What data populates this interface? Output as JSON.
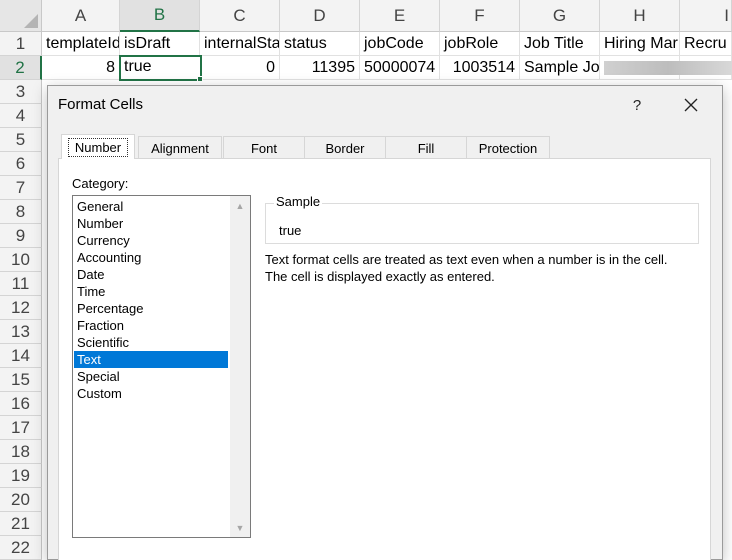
{
  "sheet": {
    "columns": [
      "A",
      "B",
      "C",
      "D",
      "E",
      "F",
      "G",
      "H",
      "I"
    ],
    "rows": [
      "1",
      "2",
      "3",
      "4",
      "5",
      "6",
      "7",
      "8",
      "9",
      "10",
      "11",
      "12",
      "13",
      "14",
      "15",
      "16",
      "17",
      "18",
      "19",
      "20",
      "21",
      "22"
    ],
    "header_row": [
      "templateId",
      "isDraft",
      "internalSta",
      "status",
      "jobCode",
      "jobRole",
      "Job Title",
      "Hiring Mar",
      "Recru"
    ],
    "data_row": [
      "8",
      "true",
      "0",
      "11395",
      "50000074",
      "1003514",
      "Sample Jol",
      "",
      ""
    ],
    "selected_cell": "B2",
    "accent_color": "#217346"
  },
  "dialog": {
    "title": "Format Cells",
    "help_label": "?",
    "tabs": [
      "Number",
      "Alignment",
      "Font",
      "Border",
      "Fill",
      "Protection"
    ],
    "selected_tab": "Number",
    "category_label": "Category:",
    "categories": [
      "General",
      "Number",
      "Currency",
      "Accounting",
      "Date",
      "Time",
      "Percentage",
      "Fraction",
      "Scientific",
      "Text",
      "Special",
      "Custom"
    ],
    "selected_category": "Text",
    "sample_label": "Sample",
    "sample_value": "true",
    "description_line1": "Text format cells are treated as text even when a number is in the cell.",
    "description_line2": "The cell is displayed exactly as entered.",
    "selection_color": "#0078d7",
    "icons": {
      "close": "close-icon",
      "scroll_up": "scroll-up-arrow-icon",
      "scroll_down": "scroll-down-arrow-icon"
    }
  }
}
